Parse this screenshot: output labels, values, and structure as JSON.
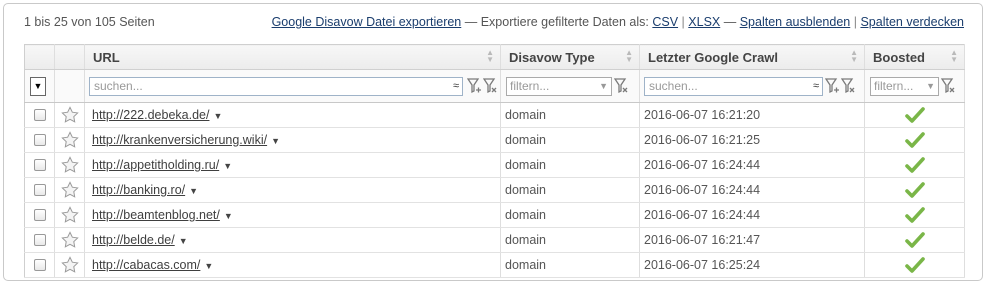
{
  "topbar": {
    "count": "1 bis 25 von 105 Seiten",
    "disavow_link": "Google Disavow Datei exportieren",
    "export_text": "— Exportiere gefilterte Daten als:",
    "csv": "CSV",
    "xlsx": "XLSX",
    "dash": "—",
    "hide_cols": "Spalten ausblenden",
    "pipe": "|",
    "cover_cols": "Spalten verdecken"
  },
  "columns": {
    "url": "URL",
    "disavow_type": "Disavow Type",
    "last_crawl": "Letzter Google Crawl",
    "boosted": "Boosted"
  },
  "filters": {
    "bulk_select": "▼",
    "url_placeholder": "suchen...",
    "type_placeholder": "filtern...",
    "crawl_placeholder": "suchen...",
    "boosted_placeholder": "filtern...",
    "approx": "≈"
  },
  "rows": [
    {
      "url": "http://222.debeka.de/",
      "type": "domain",
      "crawl": "2016-06-07 16:21:20",
      "boosted": true
    },
    {
      "url": "http://krankenversicherung.wiki/",
      "type": "domain",
      "crawl": "2016-06-07 16:21:25",
      "boosted": true
    },
    {
      "url": "http://appetitholding.ru/",
      "type": "domain",
      "crawl": "2016-06-07 16:24:44",
      "boosted": true
    },
    {
      "url": "http://banking.ro/",
      "type": "domain",
      "crawl": "2016-06-07 16:24:44",
      "boosted": true
    },
    {
      "url": "http://beamtenblog.net/",
      "type": "domain",
      "crawl": "2016-06-07 16:24:44",
      "boosted": true
    },
    {
      "url": "http://belde.de/",
      "type": "domain",
      "crawl": "2016-06-07 16:21:47",
      "boosted": true
    },
    {
      "url": "http://cabacas.com/",
      "type": "domain",
      "crawl": "2016-06-07 16:25:24",
      "boosted": true
    }
  ],
  "colors": {
    "link": "#1a3d6d",
    "check_green": "#7ab648",
    "filter_icon": "#7a7a7a"
  }
}
